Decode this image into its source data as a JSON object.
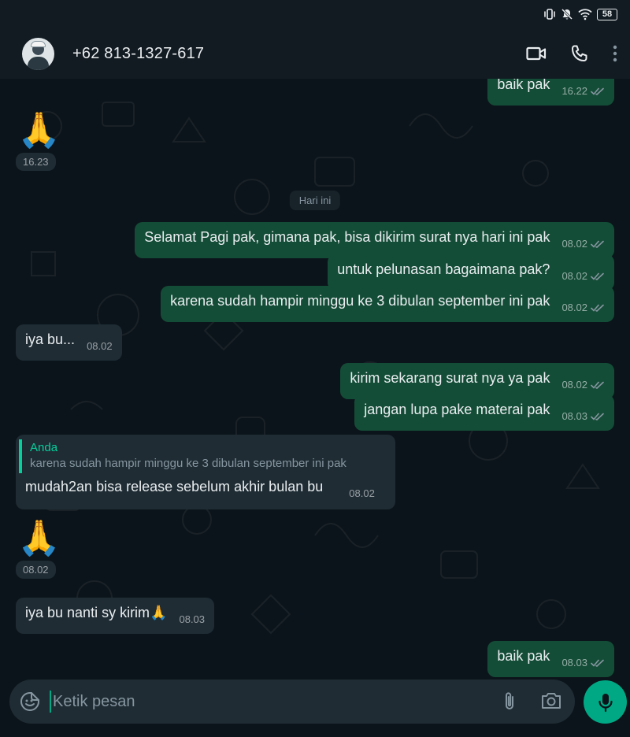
{
  "status_bar": {
    "battery": "58",
    "icons": [
      "vibrate-icon",
      "mute-icon",
      "wifi-icon",
      "battery-icon"
    ]
  },
  "header": {
    "contact_name": "+62 813-1327-617",
    "actions": [
      "video-call-icon",
      "voice-call-icon",
      "more-options-icon"
    ]
  },
  "date_divider": "Hari ini",
  "messages": [
    {
      "dir": "out",
      "text": "baik pak",
      "time": "16.22"
    },
    {
      "dir": "in",
      "emoji": "🙏",
      "time": "16.23"
    },
    {
      "dir": "out",
      "text": "Selamat Pagi pak, gimana pak, bisa dikirim surat nya hari ini pak",
      "time": "08.02"
    },
    {
      "dir": "out",
      "text": "untuk pelunasan bagaimana pak?",
      "time": "08.02"
    },
    {
      "dir": "out",
      "text": "karena sudah hampir minggu ke 3 dibulan september ini pak",
      "time": "08.02"
    },
    {
      "dir": "in",
      "text": "iya bu...",
      "time": "08.02"
    },
    {
      "dir": "out",
      "text": "kirim sekarang surat nya ya pak",
      "time": "08.02"
    },
    {
      "dir": "out",
      "text": "jangan lupa pake materai pak",
      "time": "08.03"
    },
    {
      "dir": "in",
      "quote_author": "Anda",
      "quote_text": "karena sudah hampir minggu ke 3 dibulan september ini pak",
      "text": "mudah2an bisa release sebelum akhir bulan bu",
      "time": "08.02"
    },
    {
      "dir": "in",
      "emoji": "🙏",
      "time": "08.02"
    },
    {
      "dir": "in",
      "text": "iya bu nanti sy kirim🙏",
      "time": "08.03"
    },
    {
      "dir": "out",
      "text": "baik pak",
      "time": "08.03"
    }
  ],
  "input": {
    "placeholder": "Ketik pesan"
  },
  "colors": {
    "background": "#0b141a",
    "outgoing_bubble": "#144d37",
    "incoming_bubble": "#1f2c34",
    "accent": "#00a884",
    "quote_accent": "#06cf9c"
  }
}
